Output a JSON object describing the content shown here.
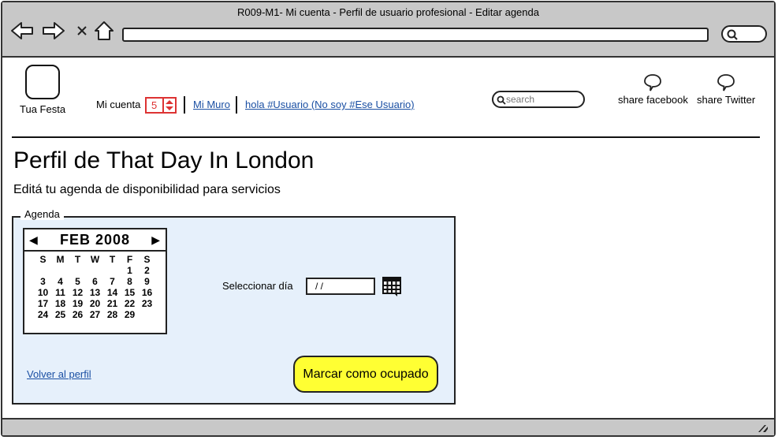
{
  "browser": {
    "title": "R009-M1- Mi cuenta - Perfil de usuario profesional - Editar agenda",
    "address": ""
  },
  "header": {
    "logo_text": "Tua Festa",
    "mi_cuenta_label": "Mi cuenta",
    "notification_count": "5",
    "mi_muro_link": "Mi Muro",
    "user_link": "hola #Usuario (No soy #Ese Usuario)",
    "search_placeholder": "search",
    "share_facebook": "share facebook",
    "share_twitter": "share Twitter"
  },
  "main": {
    "title": "Perfil de That Day In London",
    "subtitle": "Editá tu agenda de disponibilidad para servicios",
    "agenda": {
      "legend": "Agenda",
      "calendar": {
        "month_label": "FEB 2008",
        "weekdays": [
          "S",
          "M",
          "T",
          "W",
          "T",
          "F",
          "S"
        ],
        "weeks": [
          [
            "",
            "",
            "",
            "",
            "",
            "1",
            "2"
          ],
          [
            "3",
            "4",
            "5",
            "6",
            "7",
            "8",
            "9"
          ],
          [
            "10",
            "11",
            "12",
            "13",
            "14",
            "15",
            "16"
          ],
          [
            "17",
            "18",
            "19",
            "20",
            "21",
            "22",
            "23"
          ],
          [
            "24",
            "25",
            "26",
            "27",
            "28",
            "29",
            ""
          ]
        ]
      },
      "select_day_label": "Seleccionar día",
      "date_value": "/ /",
      "back_link": "Volver al perfil",
      "mark_busy_button": "Marcar como ocupado"
    }
  },
  "colors": {
    "titlebar": "#c8c8c8",
    "link": "#1a4fa3",
    "stepper": "#d33333",
    "fieldset_bg": "#e6f0fb",
    "button": "#ffff33"
  }
}
